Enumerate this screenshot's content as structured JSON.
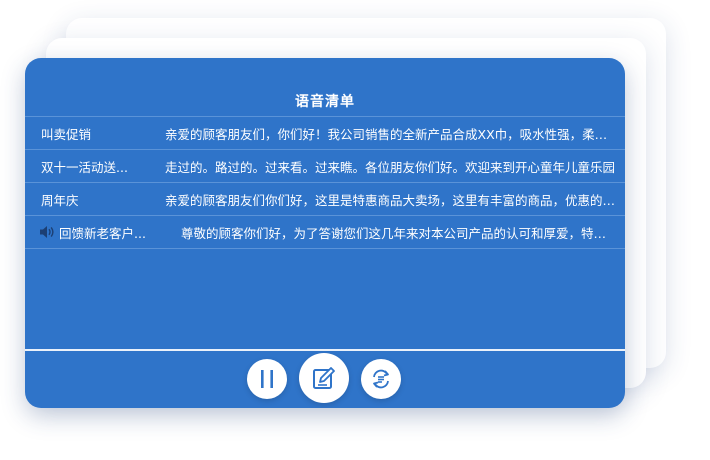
{
  "panel": {
    "title": "语音清单",
    "items": [
      {
        "name": "叫卖促销",
        "content": "亲爱的顾客朋友们，你们好！我公司销售的全新产品合成XX巾，吸水性强，柔软耐用"
      },
      {
        "name": "双十一活动送...",
        "content": "走过的。路过的。过来看。过来瞧。各位朋友你们好。欢迎来到开心童年儿童乐园"
      },
      {
        "name": "周年庆",
        "content": "亲爱的顾客朋友们你们好，这里是特惠商品大卖场，这里有丰富的商品，优惠的价格"
      },
      {
        "name": "回馈新老客户...",
        "content": "尊敬的顾客你们好，为了答谢您们这几年来对本公司产品的认可和厚爱，特举办活动"
      }
    ]
  },
  "controls": [
    {
      "name": "pause",
      "icon": "pause-icon"
    },
    {
      "name": "edit",
      "icon": "edit-icon"
    },
    {
      "name": "loop",
      "icon": "loop-list-icon"
    }
  ],
  "colors": {
    "panel": "#2f74c9",
    "divider": "#5a93d8",
    "icon": "#2f74c9"
  }
}
